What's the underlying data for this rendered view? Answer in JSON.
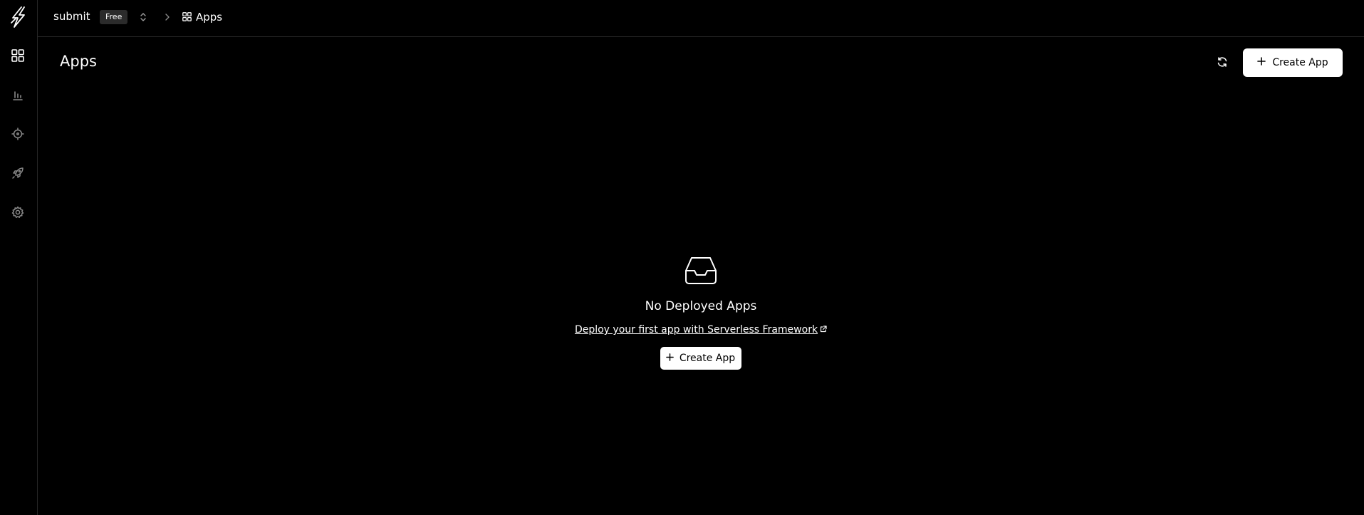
{
  "topbar": {
    "org_name": "submit",
    "plan_badge": "Free",
    "breadcrumb_current": "Apps"
  },
  "header": {
    "title": "Apps",
    "create_label": "Create App"
  },
  "empty_state": {
    "title": "No Deployed Apps",
    "link_text": "Deploy your first app with Serverless Framework",
    "create_label": "Create App"
  },
  "sidebar": {
    "items": [
      {
        "icon": "apps-grid-icon",
        "active": true
      },
      {
        "icon": "metrics-bar-chart-icon",
        "active": false
      },
      {
        "icon": "crosshair-icon",
        "active": false
      },
      {
        "icon": "rocket-icon",
        "active": false
      },
      {
        "icon": "gear-icon",
        "active": false
      }
    ]
  },
  "colors": {
    "background": "#000000",
    "border": "#262626",
    "button_bg": "#ffffff",
    "button_text": "#000000",
    "muted_icon": "#8a8a8a"
  }
}
